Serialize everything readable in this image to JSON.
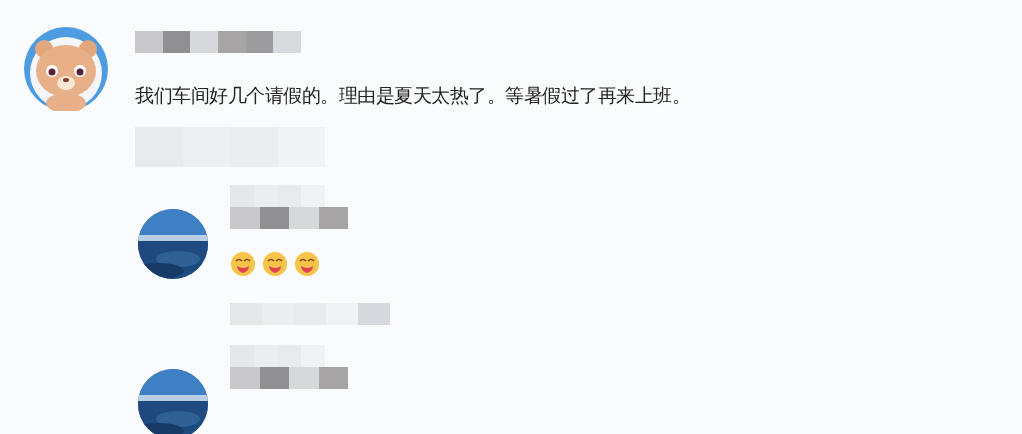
{
  "comments": [
    {
      "avatar": {
        "kind": "bear"
      },
      "author": {
        "kind": "blurred"
      },
      "text": "我们车间好几个请假的。理由是夏天太热了。等暑假过了再来上班。",
      "meta": {
        "kind": "blurred"
      },
      "replies": [
        {
          "author": {
            "kind": "blurred"
          },
          "emojis": [
            {
              "kind": "tongue"
            },
            {
              "kind": "tongue"
            },
            {
              "kind": "tongue"
            }
          ],
          "meta": {
            "kind": "blurred"
          }
        },
        {
          "author": {
            "kind": "blurred"
          }
        }
      ]
    }
  ]
}
